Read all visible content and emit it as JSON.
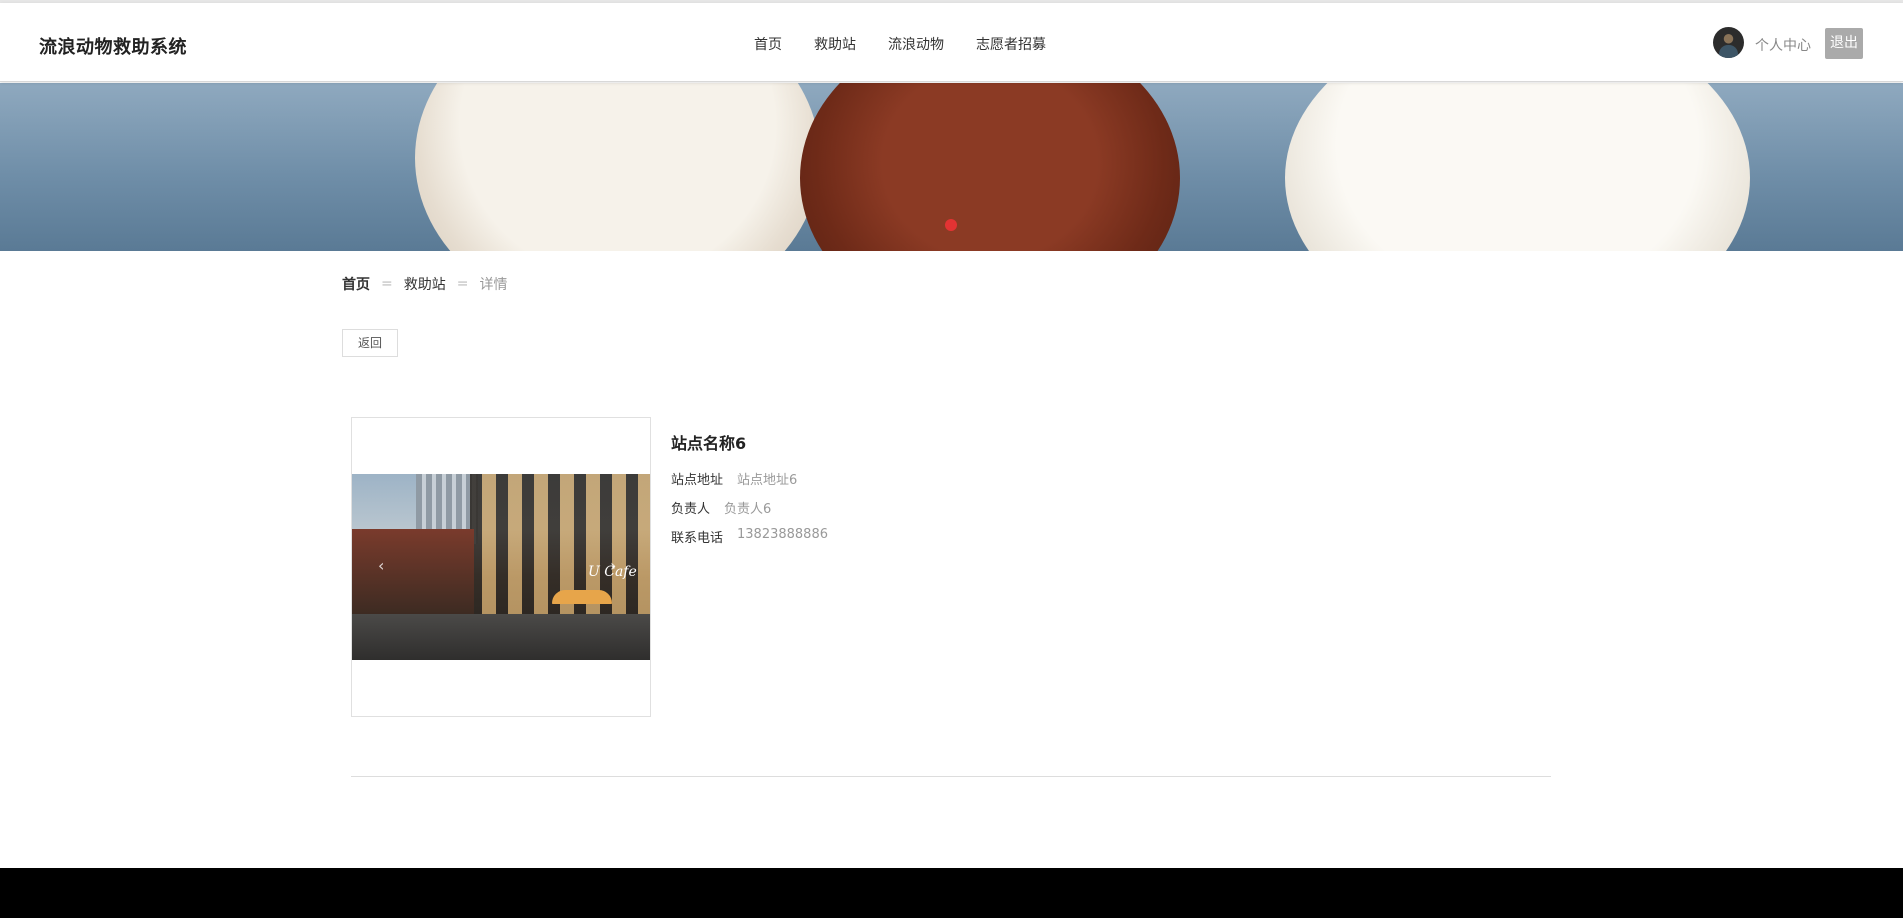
{
  "header": {
    "logo": "流浪动物救助系统",
    "nav": [
      "首页",
      "救助站",
      "流浪动物",
      "志愿者招募"
    ],
    "user_center": "个人中心",
    "logout": "退出"
  },
  "breadcrumb": {
    "home": "首页",
    "section": "救助站",
    "current": "详情",
    "separator": "="
  },
  "back_button": "返回",
  "station": {
    "name": "站点名称6",
    "address_label": "站点地址",
    "address_value": "站点地址6",
    "manager_label": "负责人",
    "manager_value": "负责人6",
    "phone_label": "联系电话",
    "phone_value": "13823888886"
  },
  "photo": {
    "sign_text": "U Cafe",
    "prev_arrow": "‹",
    "next_arrow": "›"
  },
  "colors": {
    "carousel_dot": "#e33333",
    "footer": "#000000",
    "logout_bg": "#aaaaaa"
  }
}
